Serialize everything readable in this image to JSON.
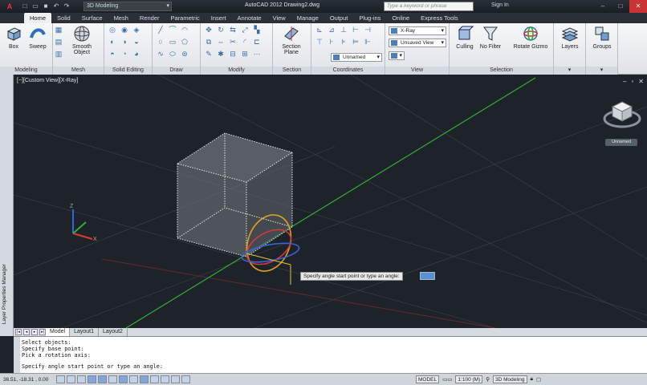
{
  "titlebar": {
    "app_button": "A",
    "workspace": "3D Modeling",
    "title": "AutoCAD 2012    Drawing2.dwg",
    "search_placeholder": "Type a keyword or phrase",
    "signin": "Sign In"
  },
  "ribbon_tabs": [
    "Home",
    "Solid",
    "Surface",
    "Mesh",
    "Render",
    "Parametric",
    "Insert",
    "Annotate",
    "View",
    "Manage",
    "Output",
    "Plug-ins",
    "Online",
    "Express Tools"
  ],
  "panels": {
    "modeling": {
      "label": "Modeling",
      "box": "Box",
      "sweep": "Sweep"
    },
    "mesh": {
      "label": "Mesh",
      "smooth_object_1": "Smooth",
      "smooth_object_2": "Object"
    },
    "solid_editing": {
      "label": "Solid Editing"
    },
    "draw": {
      "label": "Draw"
    },
    "modify": {
      "label": "Modify"
    },
    "section": {
      "label": "Section",
      "section_plane_1": "Section",
      "section_plane_2": "Plane"
    },
    "coordinates": {
      "label": "Coordinates",
      "ucs_combo": "Unnamed"
    },
    "view": {
      "label": "View",
      "visual_style": "X-Ray",
      "saved_view": "Unsaved View"
    },
    "selection": {
      "label": "Selection",
      "culling": "Culling",
      "no_filter": "No Filter",
      "rotate_gizmo": "Rotate Gizmo"
    },
    "layers": {
      "label": "Layers"
    },
    "groups": {
      "label": "Groups"
    }
  },
  "palette": {
    "layer_properties": "Layer Properties Manager"
  },
  "viewport": {
    "label": "[−][Custom View][X-Ray]",
    "navcube_label": "Unnamed",
    "tooltip": "Specify angle start point or type an angle:"
  },
  "layout_tabs": [
    "Model",
    "Layout1",
    "Layout2"
  ],
  "command_history": [
    "Select objects:",
    "Specify base point:",
    "Pick a rotation axis:",
    "Specify angle start point or type an angle:"
  ],
  "status": {
    "coords": "36.51, -18.31 , 0.00",
    "model": "MODEL",
    "scale": "1:100 (M)",
    "workspace": "3D Modeling"
  },
  "colors": {
    "viewport_bg": "#1e232a",
    "ribbon_bg": "#eef1f4",
    "green_axis": "#2fae3a",
    "red_axis": "#d83a3a"
  }
}
